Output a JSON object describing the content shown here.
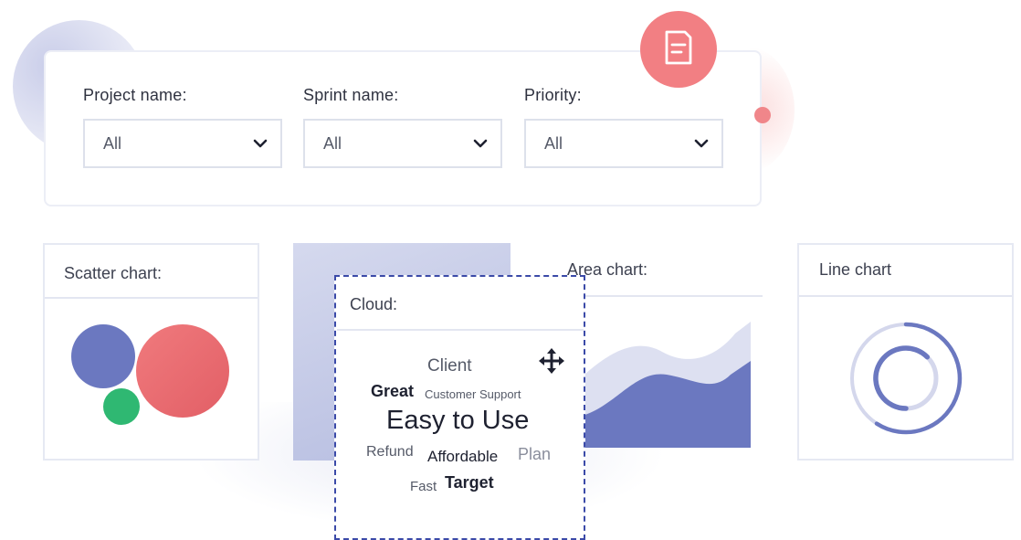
{
  "filters": {
    "project": {
      "label": "Project name:",
      "value": "All"
    },
    "sprint": {
      "label": "Sprint name:",
      "value": "All"
    },
    "priority": {
      "label": "Priority:",
      "value": "All"
    }
  },
  "cards": {
    "scatter": {
      "title": "Scatter chart:"
    },
    "cloud": {
      "title": "Cloud:"
    },
    "area": {
      "title": "Area chart:"
    },
    "line": {
      "title": "Line chart"
    }
  },
  "word_cloud": [
    {
      "text": "Client",
      "weight": "medium"
    },
    {
      "text": "Great",
      "weight": "medium-bold"
    },
    {
      "text": "Customer Support",
      "weight": "small"
    },
    {
      "text": "Easy to Use",
      "weight": "large"
    },
    {
      "text": "Refund",
      "weight": "small"
    },
    {
      "text": "Affordable",
      "weight": "medium"
    },
    {
      "text": "Plan",
      "weight": "medium"
    },
    {
      "text": "Fast",
      "weight": "small"
    },
    {
      "text": "Target",
      "weight": "medium-bold"
    }
  ],
  "icons": {
    "badge": "document-icon",
    "cursor": "move-icon",
    "dropdown": "chevron-down-icon"
  },
  "colors": {
    "accent_blue": "#6b78c0",
    "accent_red": "#ea6b6f",
    "accent_green": "#2fb872",
    "badge": "#f27f83",
    "selection_border": "#3b4aa8"
  }
}
